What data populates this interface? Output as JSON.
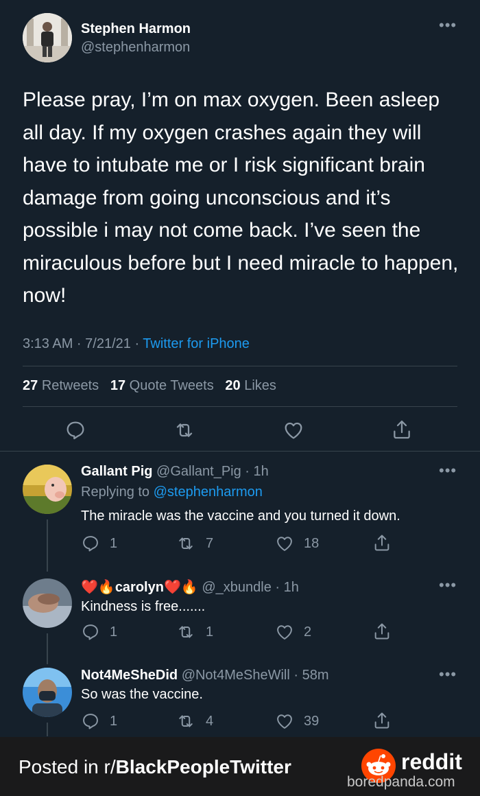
{
  "main_tweet": {
    "author_name": "Stephen Harmon",
    "handle": "@stephenharmon",
    "text": "Please pray, I’m on max oxygen. Been asleep all day. If my oxygen crashes again they will have to intubate me or I risk significant brain damage from going unconscious and it’s possible i may not come back. I’ve seen the miraculous before but I need miracle to happen, now!",
    "time": "3:13 AM · 7/21/21 · ",
    "source": "Twitter for iPhone",
    "stats": {
      "retweets_count": "27",
      "retweets_label": "Retweets",
      "quotes_count": "17",
      "quotes_label": "Quote Tweets",
      "likes_count": "20",
      "likes_label": "Likes"
    }
  },
  "replies": [
    {
      "name": "Gallant Pig",
      "handle": "@Gallant_Pig · 1h",
      "replying_prefix": "Replying to ",
      "replying_to": "@stephenharmon",
      "text": "The miracle was the vaccine and you turned it down.",
      "reply_count": "1",
      "retweet_count": "7",
      "like_count": "18"
    },
    {
      "name_prefix": "❤️🔥",
      "name": "carolyn",
      "name_suffix": "❤️🔥",
      "handle": "@_xbundle · 1h",
      "text": "Kindness is free.......",
      "reply_count": "1",
      "retweet_count": "1",
      "like_count": "2"
    },
    {
      "name": "Not4MeSheDid",
      "handle": "@Not4MeSheWill · 58m",
      "text": "So was the vaccine.",
      "reply_count": "1",
      "retweet_count": "4",
      "like_count": "39"
    }
  ],
  "footer": {
    "posted_prefix": "Posted in r/",
    "subreddit": "BlackPeopleTwitter",
    "reddit_label": "reddit",
    "watermark": "boredpanda.com"
  },
  "colors": {
    "background": "#15202b",
    "link": "#1d9bf0",
    "secondary_text": "#8b98a5",
    "divider": "#38444d",
    "footer_bg": "#1a1a1b",
    "reddit_orange": "#ff4500"
  }
}
